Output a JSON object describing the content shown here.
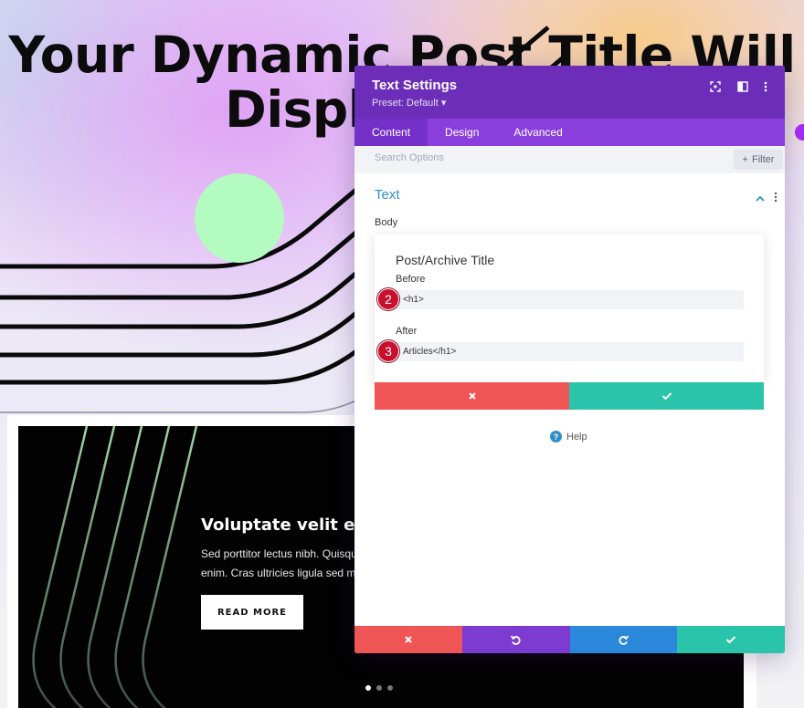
{
  "hero": {
    "title_line1": "Your Dynamic Post Title Will",
    "title_line2": "Display Here"
  },
  "card": {
    "heading": "Voluptate velit esse",
    "text_line1": "Sed porttitor lectus nibh. Quisque velit nisi, pretium ut lacinia in,",
    "text_line2": "enim. Cras ultricies ligula sed magna dictum porta.",
    "button_label": "READ MORE",
    "slides": 3,
    "active_slide": 1
  },
  "modal": {
    "title": "Text Settings",
    "preset": "Preset: Default ▾",
    "tabs": [
      "Content",
      "Design",
      "Advanced"
    ],
    "active_tab": "Content",
    "search_placeholder": "Search Options",
    "filter_label": "Filter",
    "section_title": "Text",
    "body_label": "Body",
    "dynamic_content": {
      "title": "Post/Archive Title",
      "before_label": "Before",
      "before_value": "<h1>",
      "after_label": "After",
      "after_value": "Articles</h1>",
      "before_step": "2",
      "after_step": "3"
    },
    "help_label": "Help"
  },
  "colors": {
    "modal_header": "#6c2eb9",
    "tabs_bar": "#8a3fdc",
    "accent_blue": "#2f8fc7",
    "cancel_red": "#ef5555",
    "confirm_green": "#29c4a9",
    "undo_purple": "#7c3bd1",
    "redo_blue": "#2b87da",
    "badge_red": "#c8102e"
  },
  "icons": {
    "header": [
      "fullscreen-icon",
      "split-view-icon",
      "more-options-icon"
    ],
    "footer": [
      "close-icon",
      "undo-icon",
      "redo-icon",
      "check-icon"
    ]
  }
}
